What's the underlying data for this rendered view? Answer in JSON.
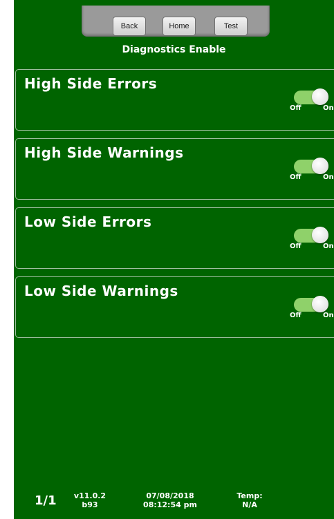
{
  "nav": {
    "back_label": "Back",
    "home_label": "Home",
    "test_label": "Test"
  },
  "title": "Diagnostics Enable",
  "settings": [
    {
      "label": "High Side Errors",
      "off_label": "Off",
      "on_label": "On",
      "state": "on"
    },
    {
      "label": "High Side Warnings",
      "off_label": "Off",
      "on_label": "On",
      "state": "on"
    },
    {
      "label": "Low Side Errors",
      "off_label": "Off",
      "on_label": "On",
      "state": "on"
    },
    {
      "label": "Low Side Warnings",
      "off_label": "Off",
      "on_label": "On",
      "state": "on"
    }
  ],
  "footer": {
    "page": "1/1",
    "version": "v11.0.2",
    "build": "b93",
    "date": "07/08/2018",
    "time": "08:12:54 pm",
    "temp_label": "Temp:",
    "temp_value": "N/A"
  },
  "colors": {
    "background": "#006400",
    "toggle_track": "#8fd16a"
  }
}
